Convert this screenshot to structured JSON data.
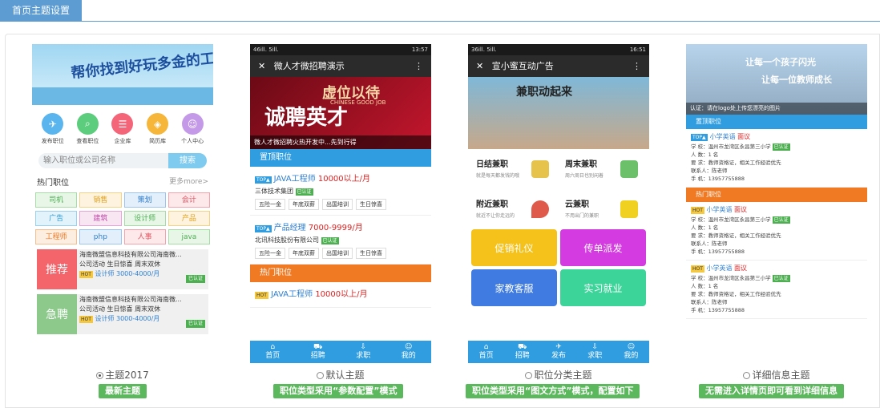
{
  "tab": {
    "label": "首页主题设置"
  },
  "themes": [
    {
      "caption": "主题2017",
      "selected": true,
      "tag": "最新主题"
    },
    {
      "caption": "默认主题",
      "selected": false,
      "tag": "职位类型采用“参数配置”模式"
    },
    {
      "caption": "职位分类主题",
      "selected": false,
      "tag": "职位类型采用“图文方式”模式，配置如下"
    },
    {
      "caption": "详细信息主题",
      "selected": false,
      "tag": "无需进入详情页即可看到详细信息"
    }
  ],
  "phone1": {
    "banner_text": "帮你找到好玩多金的工作",
    "icons": [
      {
        "label": "发布职位",
        "color": "#5ab5ef"
      },
      {
        "label": "查看职位",
        "color": "#5ccd7c"
      },
      {
        "label": "企业库",
        "color": "#f4657a"
      },
      {
        "label": "简历库",
        "color": "#f6b63a"
      },
      {
        "label": "个人中心",
        "color": "#c49ae8"
      }
    ],
    "search_placeholder": "输入职位或公司名称",
    "search_button": "搜索",
    "hot_title": "热门职位",
    "more": "更多more>",
    "categories": [
      {
        "label": "司机",
        "color": "#4caf50",
        "bg": "#e8f6e8"
      },
      {
        "label": "销售",
        "color": "#e5a21b",
        "bg": "#fdf3df"
      },
      {
        "label": "策划",
        "color": "#2e7fd3",
        "bg": "#e3effa"
      },
      {
        "label": "会计",
        "color": "#e25563",
        "bg": "#fde8ea"
      },
      {
        "label": "广告",
        "color": "#2e9bd3",
        "bg": "#e3f3fb"
      },
      {
        "label": "建筑",
        "color": "#c24aa8",
        "bg": "#f8e6f3"
      },
      {
        "label": "设计师",
        "color": "#4caf50",
        "bg": "#e8f6e8"
      },
      {
        "label": "产品",
        "color": "#e5a21b",
        "bg": "#fdf3df"
      },
      {
        "label": "工程师",
        "color": "#f07a23",
        "bg": "#fdeee2"
      },
      {
        "label": "php",
        "color": "#2e7fd3",
        "bg": "#e3effa"
      },
      {
        "label": "人事",
        "color": "#e25563",
        "bg": "#fde8ea"
      },
      {
        "label": "java",
        "color": "#4caf50",
        "bg": "#e8f6e8"
      }
    ],
    "jobs": [
      {
        "badge": "推荐",
        "color": "#f4656b",
        "company": "海南微盟信息科技有限公司海南微...",
        "perks": "公司活动  生日惊喜  周末双休",
        "hot": "HOT",
        "title": "设计师 3000-4000/月",
        "verified": "已认证"
      },
      {
        "badge": "急聘",
        "color": "#8cc98b",
        "company": "海南微盟信息科技有限公司海南微...",
        "perks": "公司活动  生日惊喜  周末双休",
        "hot": "HOT",
        "title": "设计师 3000-4000/月",
        "verified": "已认证"
      }
    ]
  },
  "phone2": {
    "status_left": "46ill.  5ill.",
    "status_right": "13:57",
    "appbar": "微人才微招聘演示",
    "banner_top": "虚位以待",
    "banner_mid": "CHINESE GOOD JOB",
    "banner_big": "诚聘英才",
    "banner_caption": "微人才微招聘火热开发中...先到行得",
    "sec1": "置顶职位",
    "jobs": [
      {
        "badge": "TOP▲",
        "title": "JAVA工程师",
        "salary": "10000以上/月",
        "company": "三体技术集团",
        "verified": "已认证",
        "chips": [
          "五险一金",
          "年底双薪",
          "出国培训",
          "生日惊喜"
        ]
      },
      {
        "badge": "TOP▲",
        "title": "产品经理",
        "salary": "7000-9999/月",
        "company": "北讯科技股份有限公司",
        "verified": "已认证",
        "chips": [
          "五险一金",
          "年底双薪",
          "出国培训",
          "生日惊喜"
        ]
      }
    ],
    "sec2": "热门职位",
    "hot_job": {
      "badge": "HOT",
      "title": "JAVA工程师",
      "salary": "10000以上/月"
    },
    "nav": [
      "首页",
      "招聘",
      "求职",
      "我的"
    ]
  },
  "phone3": {
    "status_left": "36ill.  5ill.",
    "status_right": "16:51",
    "appbar": "宣小蜜互动广告",
    "banner_title": "兼职动起来",
    "cells": [
      {
        "title": "日结兼职",
        "sub": "就是每天都发钱的哦",
        "color": "#e6c34a"
      },
      {
        "title": "周末兼职",
        "sub": "周六周日也别闲着",
        "color": "#6cc06a"
      },
      {
        "title": "附近兼职",
        "sub": "就近不让你走远的",
        "color": "#e05a4c"
      },
      {
        "title": "云兼职",
        "sub": "不用出门的兼职",
        "color": "#f0d020"
      }
    ],
    "tiles": [
      {
        "label": "促销礼仪",
        "color": "#f5c21c"
      },
      {
        "label": "传单派发",
        "color": "#d43be0"
      },
      {
        "label": "家教客服",
        "color": "#3f7be0"
      },
      {
        "label": "实习就业",
        "color": "#3dd49a"
      }
    ],
    "nav": [
      "首页",
      "招聘",
      "发布",
      "求职",
      "我的"
    ]
  },
  "phone4": {
    "banner_line1": "让每一个孩子闪光",
    "banner_line2": "让每一位教师成长",
    "banner_caption": "认证：请在logo处上传您漂亮的图片",
    "sec1": "置顶职位",
    "sec2": "热门职位",
    "jobs": [
      {
        "badge": "TOP▲",
        "title": "小学英语",
        "tag": "面议",
        "school": "学  校：温州市龙湾区永昌第三小学",
        "verified": "已认证",
        "count": "人  数：1  名",
        "req": "要  求：教师资格证，相关工作经验优先",
        "contact": "联系人：陈老师",
        "phone": "手  机：13957755888"
      },
      {
        "badge": "HOT",
        "title": "小学英语",
        "tag": "面议",
        "school": "学  校：温州市龙湾区永昌第三小学",
        "verified": "已认证",
        "count": "人  数：1  名",
        "req": "要  求：教师资格证，相关工作经验优先",
        "contact": "联系人：陈老师",
        "phone": "手  机：13957755888"
      },
      {
        "badge": "HOT",
        "title": "小学英语",
        "tag": "面议",
        "school": "学  校：温州市龙湾区永昌第三小学",
        "verified": "已认证",
        "count": "人  数：1  名",
        "req": "要  求：教师资格证，相关工作经验优先",
        "contact": "联系人：陈老师",
        "phone": "手  机：13957755888"
      }
    ]
  }
}
